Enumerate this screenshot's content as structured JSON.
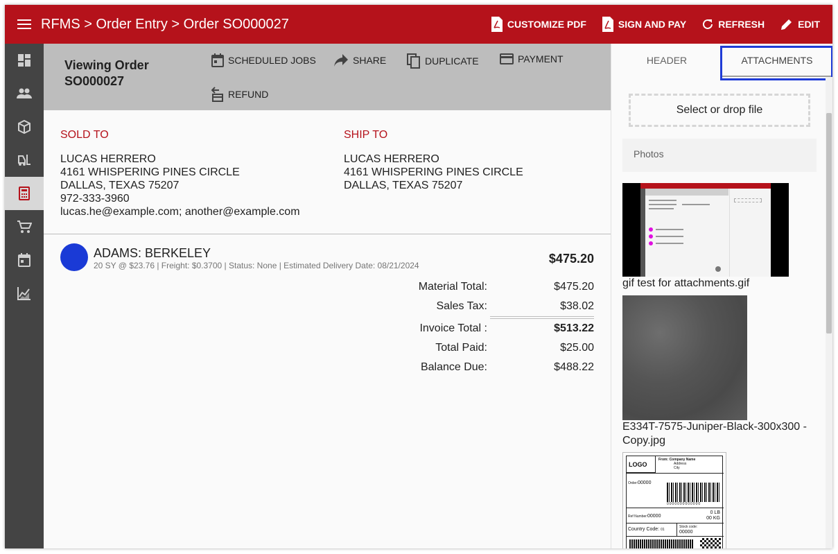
{
  "topbar": {
    "breadcrumb": "RFMS > Order Entry > Order SO000027",
    "actions": {
      "customize_pdf": "CUSTOMIZE PDF",
      "sign_and_pay": "SIGN AND PAY",
      "refresh": "REFRESH",
      "edit": "EDIT"
    }
  },
  "sidebar": {
    "items": [
      "dashboard-icon",
      "people-icon",
      "package-icon",
      "forklift-icon",
      "calculator-icon",
      "cart-icon",
      "calendar-icon",
      "chart-icon"
    ],
    "active_index": 4
  },
  "order": {
    "title": "Viewing Order SO000027",
    "actions": {
      "scheduled_jobs": "SCHEDULED JOBS",
      "share": "SHARE",
      "duplicate": "DUPLICATE",
      "payment": "PAYMENT",
      "refund": "REFUND"
    }
  },
  "sold_to": {
    "heading": "SOLD TO",
    "name": "LUCAS HERRERO",
    "street": "4161 WHISPERING PINES CIRCLE",
    "city": "DALLAS, TEXAS 75207",
    "phone": "972-333-3960",
    "email": "lucas.he@example.com; another@example.com"
  },
  "ship_to": {
    "heading": "SHIP TO",
    "name": "LUCAS HERRERO",
    "street": "4161 WHISPERING PINES CIRCLE",
    "city": "DALLAS, TEXAS 75207"
  },
  "line_item": {
    "name": "ADAMS: BERKELEY",
    "detail": "20 SY @ $23.76  |  Freight: $0.3700  |  Status: None  |  Estimated Delivery Date: 08/21/2024",
    "price": "$475.20",
    "avatar_color": "#1a3ad6"
  },
  "totals": {
    "material_total_label": "Material Total:",
    "material_total": "$475.20",
    "sales_tax_label": "Sales Tax:",
    "sales_tax": "$38.02",
    "invoice_total_label": "Invoice Total :",
    "invoice_total": "$513.22",
    "total_paid_label": "Total Paid:",
    "total_paid": "$25.00",
    "balance_due_label": "Balance Due:",
    "balance_due": "$488.22"
  },
  "right_panel": {
    "tabs": {
      "header": "HEADER",
      "attachments": "ATTACHMENTS"
    },
    "drop_zone": "Select or drop file",
    "photos_label": "Photos",
    "attachments": [
      {
        "caption": "gif test for attachments.gif"
      },
      {
        "caption": "E334T-7575-Juniper-Black-300x300 - Copy.jpg"
      },
      {
        "caption": ""
      }
    ],
    "label_thumb": {
      "logo": "LOGO",
      "from": "From:",
      "company": "Company Name",
      "address": "Address",
      "city": "City",
      "order": "Order:",
      "order_no": "00000",
      "barcode_digits": "0000000000000",
      "ref": "Ref Number:",
      "ref_no": "00000",
      "weight_lb": "0 LB",
      "weight_kg": "00 KG",
      "country": "Country Code:",
      "country_code": "01",
      "stock": "Stock code:",
      "stock_no": "00000"
    }
  },
  "colors": {
    "brand_red": "#b5121b",
    "sidebar": "#444444",
    "focus_blue": "#1f3bd6"
  }
}
